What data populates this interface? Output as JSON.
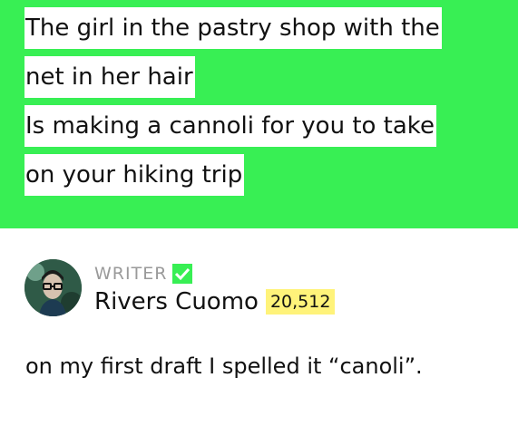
{
  "lyrics": {
    "lines": [
      "The girl in the pastry shop with the",
      "net in her hair",
      "Is making a cannoli for you to take",
      "on your hiking trip"
    ],
    "highlight_color": "#38ef54"
  },
  "annotation": {
    "role": "WRITER",
    "verified_icon": "check-icon",
    "author": "Rivers Cuomo",
    "iq": "20,512",
    "body": "on my first draft I spelled it “canoli”."
  }
}
